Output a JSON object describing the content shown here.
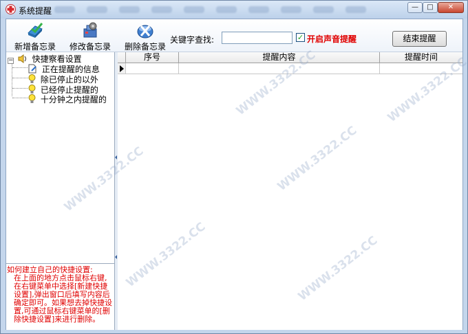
{
  "window": {
    "title": "系统提醒",
    "controls": {
      "minimize": "—",
      "maximize": "□",
      "close": "✕"
    }
  },
  "toolbar": {
    "add_label": "新增备忘录",
    "edit_label": "修改备忘录",
    "delete_label": "删除备忘录",
    "search_label": "关键字查找:",
    "search_value": "",
    "sound_checked": true,
    "sound_label": "开启声音提醒",
    "end_label": "结束提醒"
  },
  "tree": {
    "root": "快捷察看设置",
    "items": [
      {
        "label": "正在提醒的信息",
        "icon": "document-edit-icon"
      },
      {
        "label": "除已停止的以外",
        "icon": "lightbulb-icon"
      },
      {
        "label": "已经停止提醒的",
        "icon": "lightbulb-icon"
      },
      {
        "label": "十分钟之内提醒的",
        "icon": "lightbulb-icon"
      }
    ]
  },
  "help": {
    "line1": "如何建立自己的快捷设置:",
    "line2": "在上面的地方点击鼠标右键,在右键菜单中选择[新建快捷设置],弹出窗口后填写内容后确定即可。如果想去掉快捷设置,可通过鼠标右键菜单的[删除快捷设置]来进行删除。"
  },
  "grid": {
    "columns": [
      "序号",
      "提醒内容",
      "提醒时间"
    ]
  },
  "watermark": "WWW.3322.CC",
  "colors": {
    "accent_red": "#e00000",
    "frame": "#c4d6ec",
    "checkbox_check": "#21a121"
  }
}
